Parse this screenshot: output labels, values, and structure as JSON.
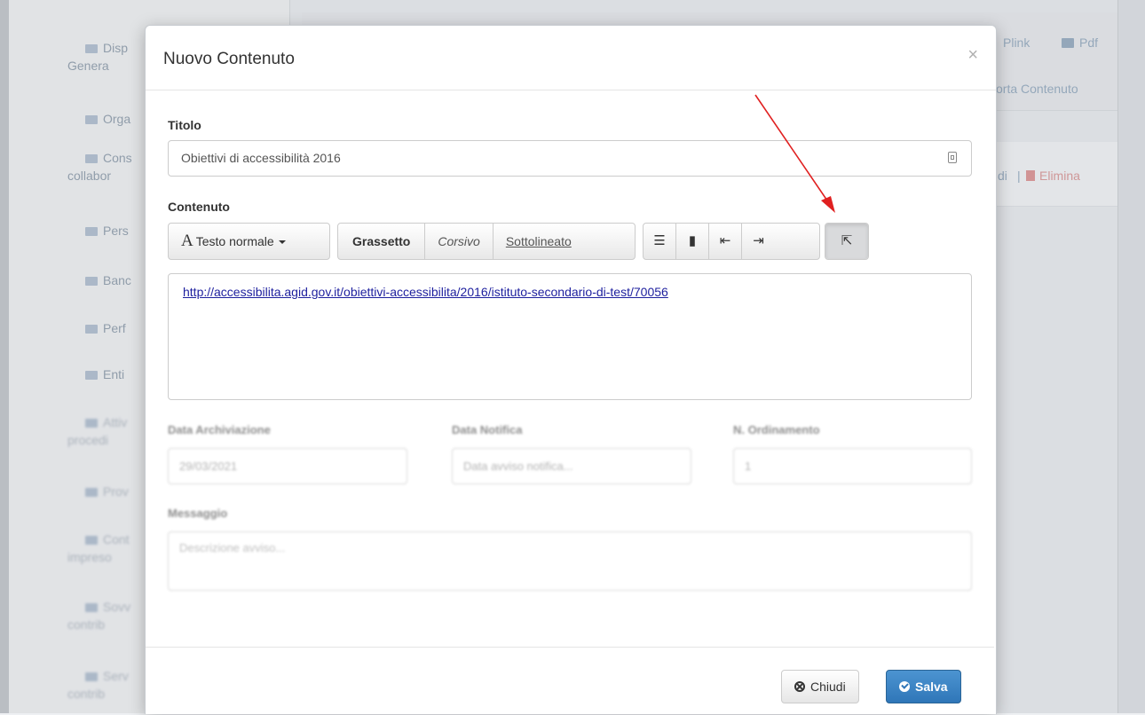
{
  "background": {
    "sidebar_items": [
      {
        "label": "Disp",
        "label2": "Genera"
      },
      {
        "label": "Orga"
      },
      {
        "label": "Cons",
        "label2": "collabor"
      },
      {
        "label": "Pers"
      },
      {
        "label": "Banc"
      },
      {
        "label": "Perf"
      },
      {
        "label": "Enti"
      },
      {
        "label": "Attiv",
        "label2": "procedi"
      },
      {
        "label": "Prov"
      },
      {
        "label": "Cont",
        "label2": "impreso"
      },
      {
        "label": "Sovv",
        "label2": "contrib"
      },
      {
        "label": "Serv",
        "label2": "contrib"
      }
    ],
    "toolbar": {
      "plink": "Plink",
      "pdf": "Pdf",
      "export": "orta Contenuto"
    },
    "row": {
      "edit": "di",
      "separator": "|",
      "delete": "Elimina"
    }
  },
  "modal": {
    "title": "Nuovo Contenuto",
    "close_symbol": "×",
    "title_label": "Titolo",
    "title_value": "Obiettivi di accessibilità 2016",
    "content_label": "Contenuto",
    "editor_toolbar": {
      "font_letter": "A",
      "font_style": "Testo normale",
      "bold": "Grassetto",
      "italic": "Corsivo",
      "underline": "Sottolineato",
      "icons": [
        "unordered-list-icon",
        "ordered-list-icon",
        "outdent-icon",
        "indent-icon",
        "link-icon"
      ]
    },
    "editor_link": "http://accessibilita.agid.gov.it/obiettivi-accessibilita/2016/istituto-secondario-di-test/70056",
    "archive_date_label": "Data Archiviazione",
    "archive_date_value": "29/03/2021",
    "notify_date_label": "Data Notifica",
    "notify_date_placeholder": "Data avviso notifica...",
    "order_label": "N. Ordinamento",
    "order_value": "1",
    "message_label": "Messaggio",
    "message_placeholder": "Descrizione avviso...",
    "close_button": "Chiudi",
    "save_button": "Salva"
  },
  "colors": {
    "annotation_arrow": "#e02020",
    "save_button": "#337ab7",
    "link": "#1d1f9e"
  }
}
